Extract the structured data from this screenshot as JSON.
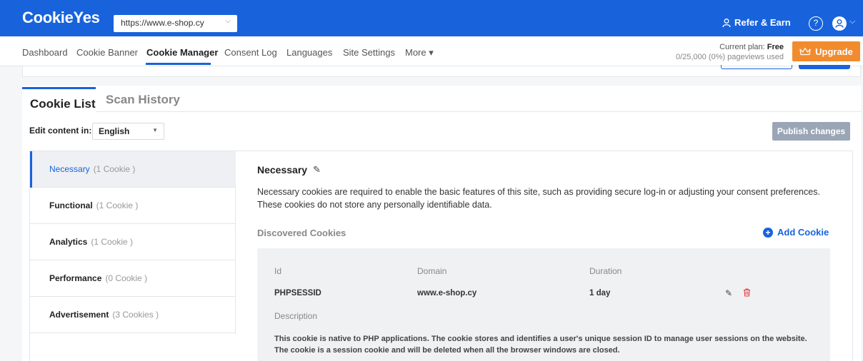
{
  "app": {
    "logo": "CookieYes",
    "site": "https://www.e-shop.cy",
    "refer": "Refer & Earn",
    "help": "?"
  },
  "nav": {
    "items": [
      "Dashboard",
      "Cookie Banner",
      "Cookie Manager",
      "Consent Log",
      "Languages",
      "Site Settings",
      "More ▾"
    ],
    "active": "Cookie Manager",
    "plan_label": "Current plan:",
    "plan_value": "Free",
    "pageviews": "0/25,000 (0%) pageviews used",
    "upgrade": "Upgrade"
  },
  "tabs": {
    "cookie_list": "Cookie List",
    "scan_history": "Scan History"
  },
  "toolbar": {
    "edit_label": "Edit content in:",
    "language": "English",
    "publish": "Publish changes"
  },
  "categories": [
    {
      "name": "Necessary",
      "count": "(1 Cookie )"
    },
    {
      "name": "Functional",
      "count": "(1 Cookie )"
    },
    {
      "name": "Analytics",
      "count": "(1 Cookie )"
    },
    {
      "name": "Performance",
      "count": "(0 Cookie )"
    },
    {
      "name": "Advertisement",
      "count": "(3 Cookies )"
    }
  ],
  "detail": {
    "title": "Necessary",
    "description": "Necessary cookies are required to enable the basic features of this site, such as providing secure log-in or adjusting your consent preferences. These cookies do not store any personally identifiable data.",
    "discovered_label": "Discovered Cookies",
    "add_cookie": "Add Cookie",
    "headers": {
      "id": "Id",
      "domain": "Domain",
      "duration": "Duration"
    },
    "cookie": {
      "id": "PHPSESSID",
      "domain": "www.e-shop.cy",
      "duration": "1 day",
      "description_label": "Description",
      "description": "This cookie is native to PHP applications. The cookie stores and identifies a user's unique session ID to manage user sessions on the website. The cookie is a session cookie and will be deleted when all the browser windows are closed."
    }
  },
  "colors": {
    "brand": "#1863dc",
    "upgrade": "#f28b2e",
    "publish_disabled": "#9aa6b6",
    "delete": "#e03c3c"
  }
}
